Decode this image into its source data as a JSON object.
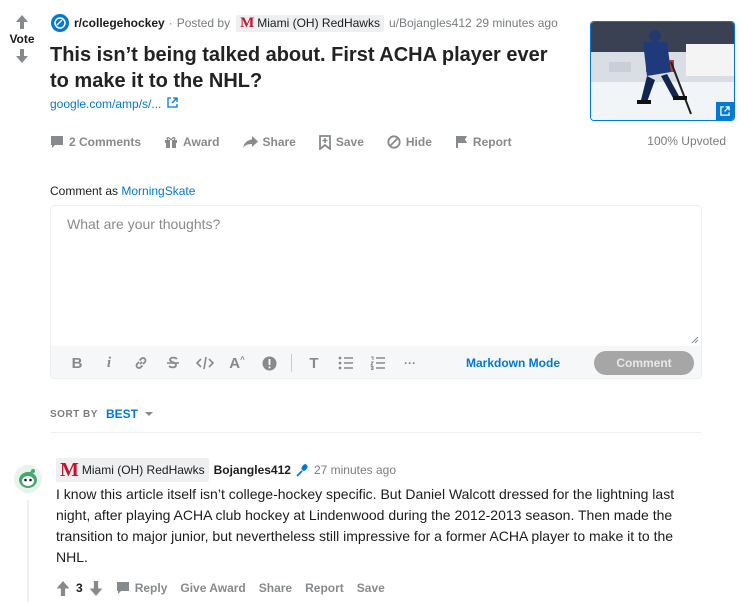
{
  "post": {
    "vote_label": "Vote",
    "subreddit": "r/collegehockey",
    "posted_by": "Posted by",
    "flair": "Miami (OH) RedHawks",
    "author": "u/Bojangles412",
    "time": "29 minutes ago",
    "title": "This isn’t being talked about. First ACHA player ever to make it to the NHL?",
    "link": "google.com/amp/s/..."
  },
  "actions": {
    "comments": "2 Comments",
    "award": "Award",
    "share": "Share",
    "save": "Save",
    "hide": "Hide",
    "report": "Report",
    "upvoted": "100% Upvoted"
  },
  "compose": {
    "comment_as_label": "Comment as",
    "username": "MorningSkate",
    "placeholder": "What are your thoughts?",
    "markdown_mode": "Markdown Mode",
    "submit": "Comment",
    "toolbar": {
      "bold": "B",
      "italic": "i",
      "superscript": "A",
      "heading": "T",
      "more": "···"
    }
  },
  "sort": {
    "label": "SORT BY",
    "value": "BEST"
  },
  "comment": {
    "flair": "Miami (OH) RedHawks",
    "author": "Bojangles412",
    "time": "27 minutes ago",
    "body": "I know this article itself isn’t college-hockey specific. But Daniel Walcott dressed for the lightning last night, after playing ACHA club hockey at Lindenwood during the 2012-2013 season. Then made the transition to major junior, but nevertheless still impressive for a former ACHA player to make it to the NHL.",
    "score": "3",
    "reply": "Reply",
    "give_award": "Give Award",
    "share": "Share",
    "report": "Report",
    "save": "Save"
  },
  "colors": {
    "accent": "#0079d3",
    "muted": "#878a8c",
    "miami_red": "#c3142d"
  }
}
